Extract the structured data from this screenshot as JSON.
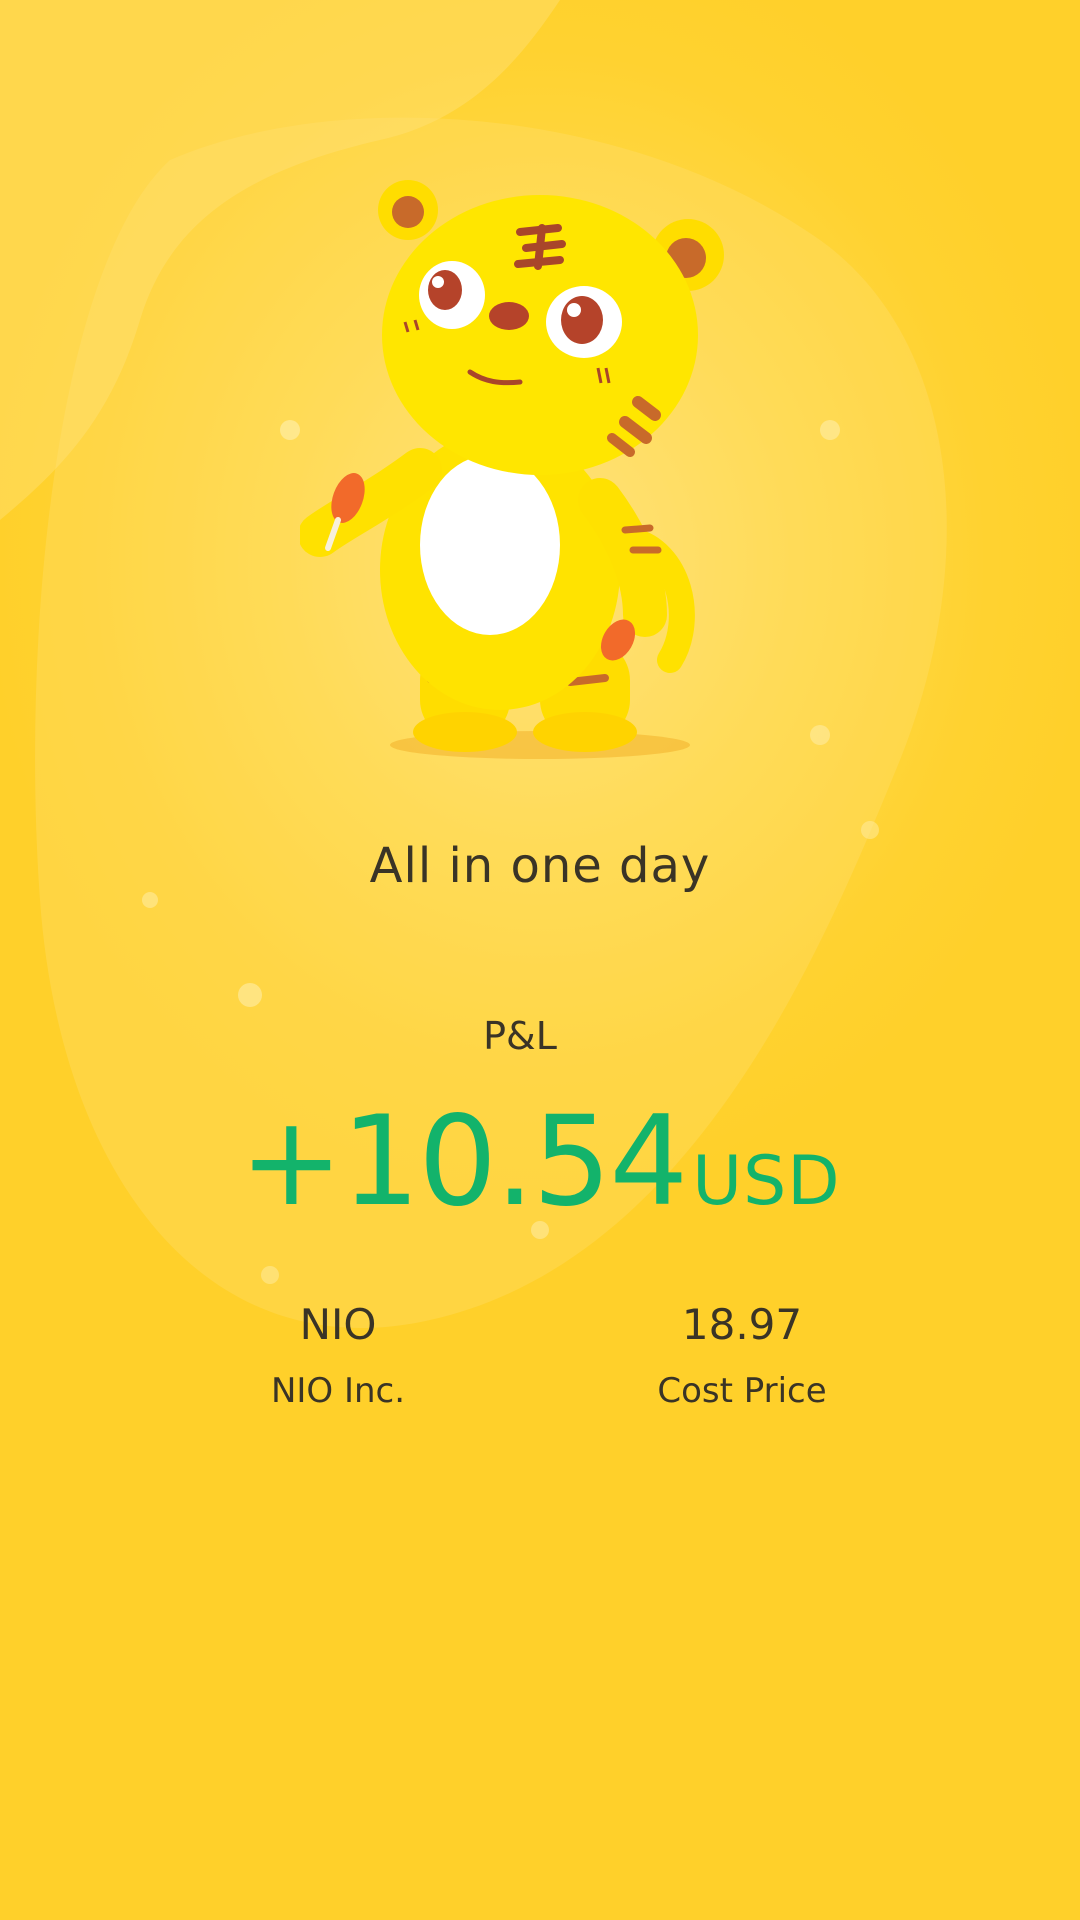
{
  "header": {
    "tagline": "All in one day"
  },
  "pnl": {
    "label": "P&L",
    "value": "+10.54",
    "currency": "USD",
    "color": "#13B36B"
  },
  "stock": {
    "symbol": "NIO",
    "name": "NIO Inc."
  },
  "cost": {
    "value": "18.97",
    "label": "Cost Price"
  },
  "theme": {
    "background": "#FFD230",
    "text": "#3A3426"
  },
  "illustration": {
    "icon": "tiger-mascot-icon"
  }
}
